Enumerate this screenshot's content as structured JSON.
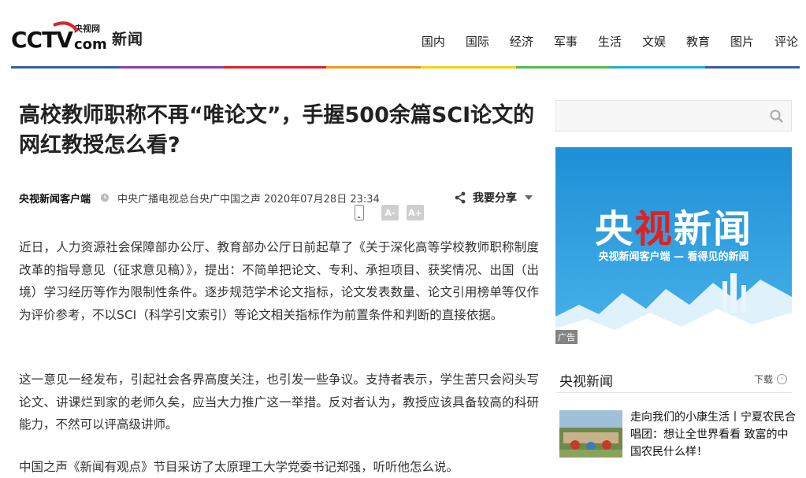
{
  "header": {
    "logo_top": "央视网",
    "logo_text": "CCTV",
    "logo_com": "com",
    "logo_news": "新闻",
    "nav": [
      "国内",
      "国际",
      "经济",
      "军事",
      "生活",
      "文娱",
      "教育",
      "图片",
      "评论"
    ],
    "rainbow_colors": [
      "#3b5ba5",
      "#8c3fa0",
      "#d9232d",
      "#f09a1a",
      "#f1d21c",
      "#54b848",
      "#2aa8d8",
      "#3b5ba5"
    ]
  },
  "article": {
    "title": "高校教师职称不再“唯论文”，手握500余篇SCI论文的网红教授怎么看?",
    "source": "央视新闻客户端",
    "outlet": "中央广播电视总台央广中国之声",
    "time": "2020年07月28日 23:34",
    "share_label": "我要分享",
    "font_smaller": "A-",
    "font_larger": "A+",
    "paragraphs": [
      "近日，人力资源社会保障部办公厅、教育部办公厅日前起草了《关于深化高等学校教师职称制度改革的指导意见（征求意见稿）》，提出：不简单把论文、专利、承担项目、获奖情况、出国（出境）学习经历等作为限制性条件。逐步规范学术论文指标，论文发表数量、论文引用榜单等仅作为评价参考，不以SCI（科学引文索引）等论文相关指标作为前置条件和判断的直接依据。",
      "这一意见一经发布，引起社会各界高度关注，也引发一些争议。支持者表示，学生苦只会闷头写论文、讲课烂到家的老师久矣，应当大力推广这一举措。反对者认为，教授应该具备较高的科研能力，不然可以评高级讲师。",
      "中国之声《新闻有观点》节目采访了太原理工大学党委书记郑强，听听他怎么说。"
    ]
  },
  "sidebar": {
    "search_placeholder": "",
    "ad": {
      "title": "央视新闻",
      "subtitle": "央视新闻客户端 — 看得见的新闻",
      "tag": "广告"
    },
    "section_title": "央视新闻",
    "download_label": "下载",
    "items": [
      {
        "text": "走向我们的小康生活丨宁夏农民合唱团：想让全世界看看 致富的中国农民什么样！"
      }
    ]
  },
  "colors": {
    "ad_blue": "#2a9ad8",
    "ad_red": "#e02020"
  }
}
